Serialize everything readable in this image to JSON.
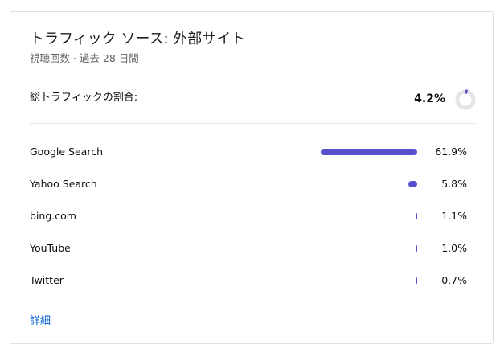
{
  "card": {
    "title": "トラフィック ソース: 外部サイト",
    "subtitle": "視聴回数 · 過去 28 日間",
    "summary": {
      "label": "総トラフィックの割合:",
      "value": "4.2%",
      "fraction": 0.042
    },
    "rows": [
      {
        "label": "Google Search",
        "value": "61.9%",
        "fraction": 0.619
      },
      {
        "label": "Yahoo Search",
        "value": "5.8%",
        "fraction": 0.058
      },
      {
        "label": "bing.com",
        "value": "1.1%",
        "fraction": 0.011
      },
      {
        "label": "YouTube",
        "value": "1.0%",
        "fraction": 0.01
      },
      {
        "label": "Twitter",
        "value": "0.7%",
        "fraction": 0.007
      }
    ],
    "details_link": "詳細"
  },
  "colors": {
    "bar": "#5a4fcf",
    "donut_track": "#e5e5e5",
    "link": "#065fd4"
  }
}
